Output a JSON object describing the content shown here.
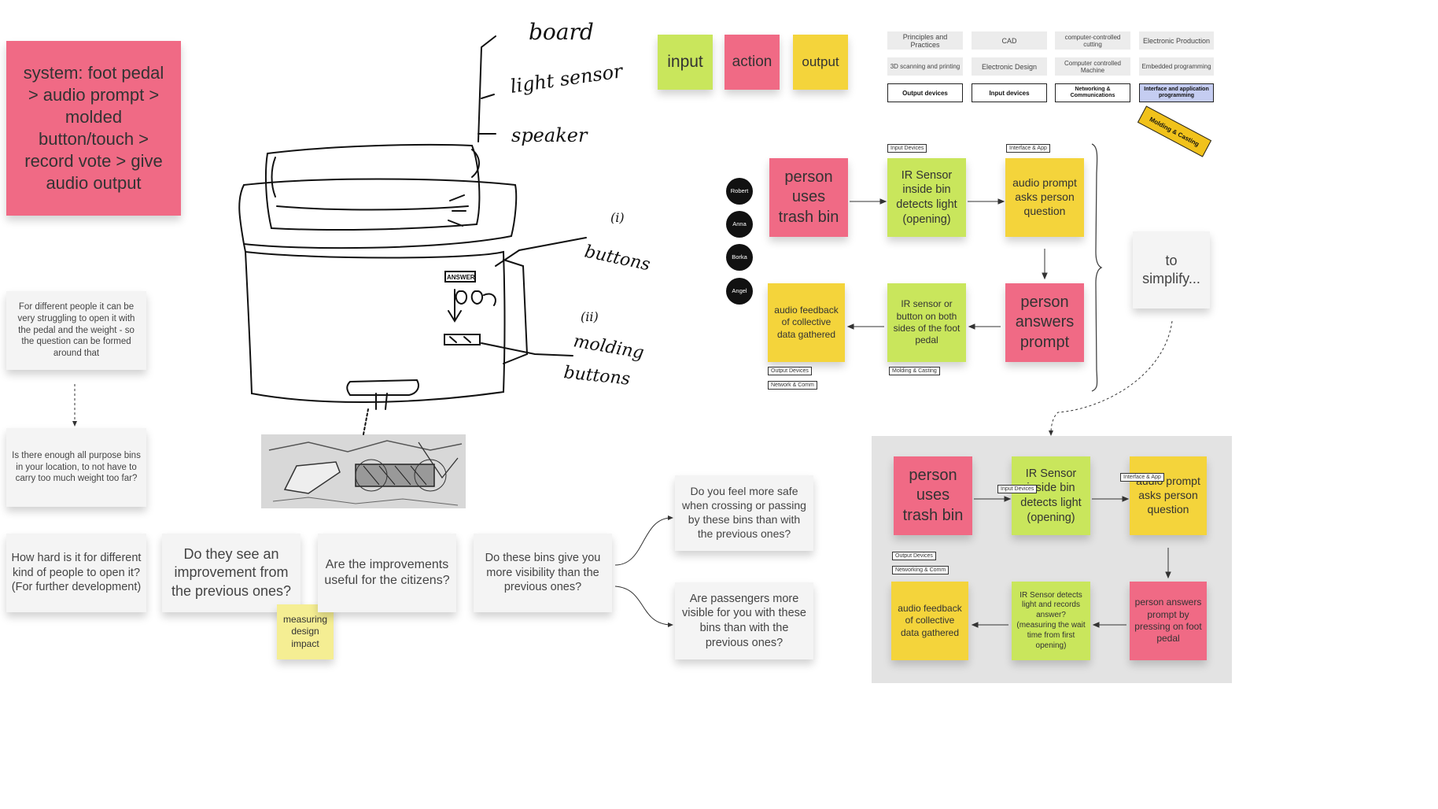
{
  "system_note": "system: foot pedal > audio prompt > molded button/touch > record vote > give audio output",
  "legend": {
    "input": "input",
    "action": "action",
    "output": "output"
  },
  "topics": {
    "row1": [
      "Principles and Practices",
      "CAD",
      "computer-controlled cutting",
      "Electronic Production"
    ],
    "row2": [
      "3D scanning and printing",
      "Electronic Design",
      "Computer controlled Machine",
      "Embedded programming"
    ],
    "row3": [
      "Output devices",
      "Input devices",
      "Networking & Communications",
      "Interface and application programming"
    ],
    "diagonal": "Molding & Casting"
  },
  "people": [
    "Robert",
    "Anna",
    "Borka",
    "Angel"
  ],
  "flow1": {
    "uses": "person uses trash bin",
    "sensor": "IR Sensor inside bin detects light (opening)",
    "prompt": "audio prompt asks person question",
    "answers": "person answers prompt",
    "pedal": "IR sensor or button on both sides of the foot pedal",
    "feedback": "audio feedback of collective data gathered",
    "tags": {
      "input": "Input Devices",
      "interface": "Interface & App",
      "molding": "Molding & Casting",
      "output": "Output Devices",
      "network": "Network & Comm"
    }
  },
  "simplify": "to simplify...",
  "flow2": {
    "uses": "person uses trash bin",
    "sensor": "IR Sensor inside bin detects light (opening)",
    "prompt": "audio prompt asks person question",
    "answers": "person answers prompt by pressing on foot pedal",
    "records": "IR Sensor detects light and records answer? (measuring the wait time from first opening)",
    "feedback": "audio feedback of collective data gathered",
    "tags": {
      "input": "Input Devices",
      "interface": "Interface & App",
      "output": "Output Devices",
      "network": "Networking & Comm"
    }
  },
  "sketch": {
    "board": "board",
    "light": "light sensor",
    "speaker": "speaker",
    "n1": "(i)",
    "buttons": "buttons",
    "n2": "(ii)",
    "molding1": "molding",
    "molding2": "buttons",
    "answer": "ANSWER"
  },
  "questions": {
    "struggle": "For different people it can be very struggling to open it with the pedal and the weight - so the question can be formed around that",
    "enough": "Is there enough all purpose bins in your location, to not have to carry too much weight too far?",
    "howhard": "How hard is it for different kind of people to open it? (For further development)",
    "improvement": "Do they see an improvement from the previous ones?",
    "useful": "Are the improvements useful for the citizens?",
    "visibility": "Do these bins give you more visibility than the previous ones?",
    "safe": "Do you feel more safe when crossing or passing by these bins than with the previous ones?",
    "passengers": "Are passengers more visible for you with these bins than with the previous ones?",
    "measuring": "measuring design impact"
  }
}
